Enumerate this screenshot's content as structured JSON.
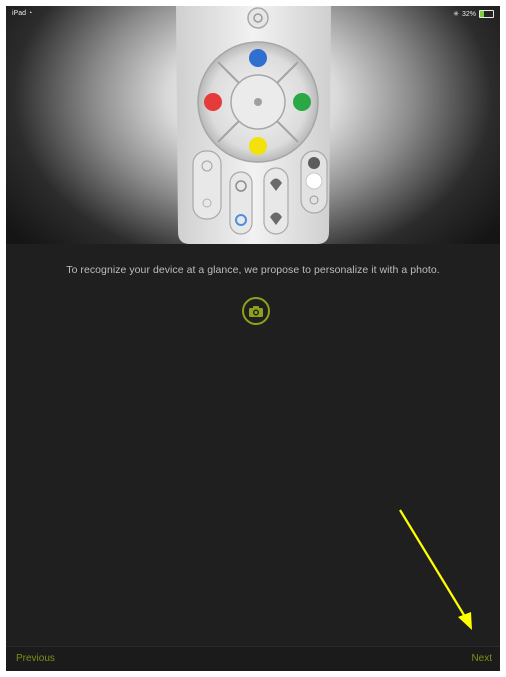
{
  "status_bar": {
    "device": "iPad",
    "wifi_icon": "wifi-icon",
    "bluetooth_icon": "bluetooth-icon",
    "battery_percent": "32%",
    "battery_level": 0.32
  },
  "hero": {
    "image": "remote-control-photo",
    "button_colors": {
      "top": "#2e6fd0",
      "left": "#e53b3b",
      "right": "#2aa845",
      "bottom": "#f3e10b"
    }
  },
  "main": {
    "message": "To recognize your device at a glance, we propose to personalize it with a photo.",
    "camera_icon": "camera-icon",
    "accent": "#8fa11a"
  },
  "nav": {
    "previous_label": "Previous",
    "next_label": "Next"
  },
  "annotation": {
    "arrow_color": "#ffff00",
    "points_to": "next-button"
  }
}
